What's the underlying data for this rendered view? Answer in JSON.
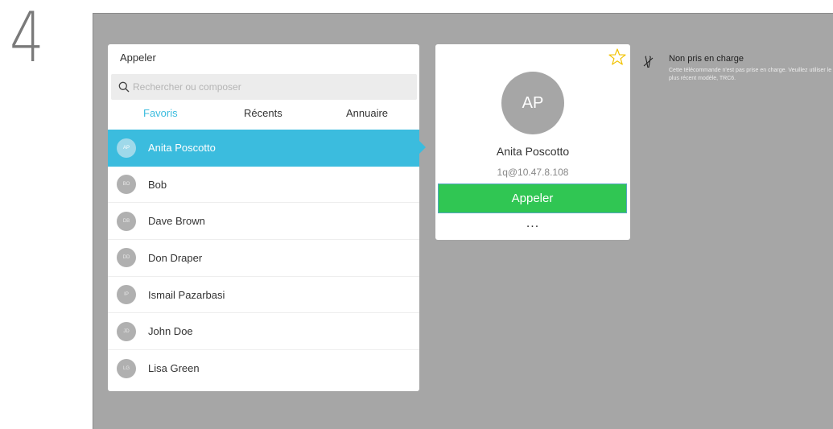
{
  "step": {
    "number": "4"
  },
  "panel": {
    "title": "Appeler",
    "search_placeholder": "Rechercher ou composer",
    "tabs": [
      {
        "label": "Favoris",
        "active": true
      },
      {
        "label": "Récents",
        "active": false
      },
      {
        "label": "Annuaire",
        "active": false
      }
    ],
    "contacts": [
      {
        "initials": "AP",
        "name": "Anita Poscotto",
        "selected": true
      },
      {
        "initials": "BO",
        "name": "Bob",
        "selected": false
      },
      {
        "initials": "DB",
        "name": "Dave Brown",
        "selected": false
      },
      {
        "initials": "DD",
        "name": "Don Draper",
        "selected": false
      },
      {
        "initials": "IP",
        "name": "Ismail Pazarbasi",
        "selected": false
      },
      {
        "initials": "JD",
        "name": "John Doe",
        "selected": false
      },
      {
        "initials": "LG",
        "name": "Lisa Green",
        "selected": false
      }
    ]
  },
  "card": {
    "initials": "AP",
    "name": "Anita Poscotto",
    "address": "1q@10.47.8.108",
    "call_label": "Appeler",
    "more_label": "...",
    "star_icon": "star-outline-icon"
  },
  "notice": {
    "icon": "remote-unsupported-icon",
    "title": "Non pris en charge",
    "text": "Cette télécommande n'est pas prise en charge. Veuillez utiliser le plus récent modèle, TRC6."
  },
  "colors": {
    "accent": "#3bbcde",
    "call_green": "#30c653",
    "screen_bg": "#a6a6a6",
    "star": "#f2c200"
  }
}
